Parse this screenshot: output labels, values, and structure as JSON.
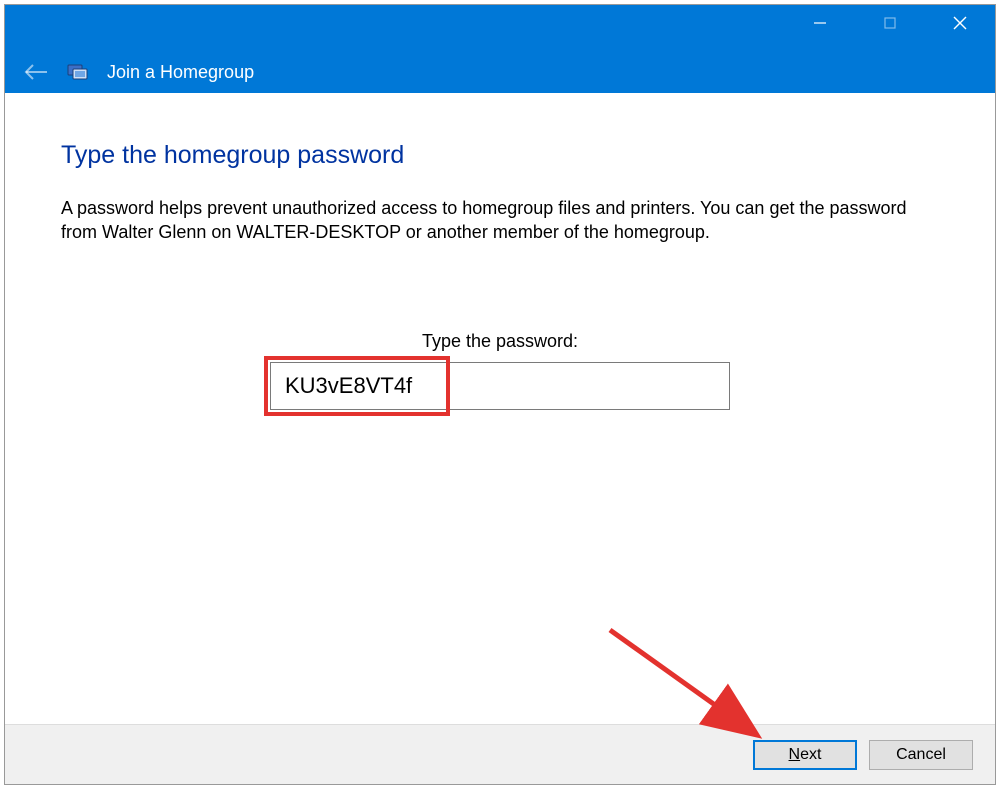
{
  "titlebar": {
    "title": "Join a Homegroup"
  },
  "page": {
    "heading": "Type the homegroup password",
    "description": "A password helps prevent unauthorized access to homegroup files and printers. You can get the password from Walter Glenn on WALTER-DESKTOP or another member of the homegroup.",
    "password_label": "Type the password:",
    "password_value": "KU3vE8VT4f"
  },
  "footer": {
    "next_prefix": "N",
    "next_rest": "ext",
    "cancel": "Cancel"
  }
}
